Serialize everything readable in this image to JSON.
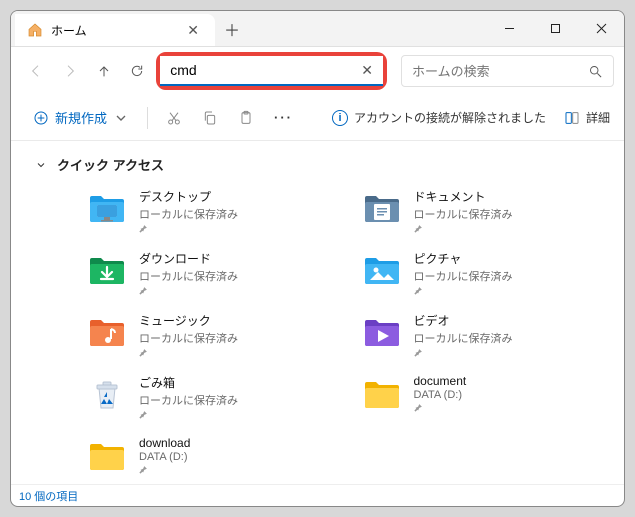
{
  "window": {
    "tab_title": "ホーム",
    "address_value": "cmd",
    "search_placeholder": "ホームの検索"
  },
  "toolbar": {
    "new_label": "新規作成",
    "more": "···",
    "account_msg": "アカウントの接続が解除されました",
    "details": "詳細"
  },
  "section": {
    "quick_access": "クイック アクセス"
  },
  "items": [
    {
      "name": "デスクトップ",
      "sub": "ローカルに保存済み",
      "icon": "desktop"
    },
    {
      "name": "ドキュメント",
      "sub": "ローカルに保存済み",
      "icon": "documents"
    },
    {
      "name": "ダウンロード",
      "sub": "ローカルに保存済み",
      "icon": "downloads"
    },
    {
      "name": "ピクチャ",
      "sub": "ローカルに保存済み",
      "icon": "pictures"
    },
    {
      "name": "ミュージック",
      "sub": "ローカルに保存済み",
      "icon": "music"
    },
    {
      "name": "ビデオ",
      "sub": "ローカルに保存済み",
      "icon": "videos"
    },
    {
      "name": "ごみ箱",
      "sub": "ローカルに保存済み",
      "icon": "recycle"
    },
    {
      "name": "document",
      "sub": "DATA (D:)",
      "icon": "folder"
    },
    {
      "name": "download",
      "sub": "DATA (D:)",
      "icon": "folder"
    }
  ],
  "status": "10 個の項目",
  "icons_svg": {
    "desktop": "<svg viewBox='0 0 40 40'><path d='M3 12 L3 10 Q3 8 5 8 L14 8 L17 11 L35 11 Q37 11 37 13 L37 32 Q37 34 35 34 L5 34 Q3 34 3 32 Z' fill='#1e9de6'/><rect x='3' y='14' width='34' height='20' rx='2' fill='#41b6f4'/><rect x='10' y='17' width='20' height='12' rx='1' fill='#fff'/><rect x='10' y='17' width='20' height='12' rx='1' fill='#3aa0e0'/><rect x='17' y='29' width='6' height='3' fill='#888'/><rect x='14' y='32' width='12' height='1.5' fill='#888'/></svg>",
    "documents": "<svg viewBox='0 0 40 40'><path d='M3 12 L3 10 Q3 8 5 8 L14 8 L17 11 L35 11 Q37 11 37 13 L37 32 Q37 34 35 34 L5 34 Q3 34 3 32 Z' fill='#4a6b8a'/><rect x='3' y='14' width='34' height='20' rx='2' fill='#6b8fb0'/><rect x='12' y='16' width='16' height='16' rx='1' fill='#fff'/><rect x='15' y='20' width='10' height='1.5' fill='#6b8fb0'/><rect x='15' y='23' width='10' height='1.5' fill='#6b8fb0'/><rect x='15' y='26' width='7' height='1.5' fill='#6b8fb0'/></svg>",
    "downloads": "<svg viewBox='0 0 40 40'><path d='M3 12 L3 10 Q3 8 5 8 L14 8 L17 11 L35 11 Q37 11 37 13 L37 32 Q37 34 35 34 L5 34 Q3 34 3 32 Z' fill='#0f8a4c'/><rect x='3' y='14' width='34' height='20' rx='2' fill='#1db663'/><path d='M20 17 L20 26 M15 22 L20 27 L25 22 M14 29 L26 29' stroke='#fff' stroke-width='2.2' fill='none' stroke-linecap='round' stroke-linejoin='round'/></svg>",
    "pictures": "<svg viewBox='0 0 40 40'><path d='M3 12 L3 10 Q3 8 5 8 L14 8 L17 11 L35 11 Q37 11 37 13 L37 32 Q37 34 35 34 L5 34 Q3 34 3 32 Z' fill='#1e9de6'/><rect x='3' y='14' width='34' height='20' rx='2' fill='#41b6f4'/><circle cx='14' cy='20' r='2.5' fill='#fff'/><path d='M8 30 L16 22 L22 28 L26 24 L32 30 Z' fill='#fff'/></svg>",
    "music": "<svg viewBox='0 0 40 40'><path d='M3 12 L3 10 Q3 8 5 8 L14 8 L17 11 L35 11 Q37 11 37 13 L37 32 Q37 34 35 34 L5 34 Q3 34 3 32 Z' fill='#e8602c'/><rect x='3' y='14' width='34' height='20' rx='2' fill='#f5844e'/><path d='M24 17 L24 27' stroke='#fff' stroke-width='2' fill='none'/><circle cx='21' cy='28' r='3' fill='#fff'/><path d='M24 17 Q28 18 28 21' stroke='#fff' stroke-width='2' fill='none'/></svg>",
    "videos": "<svg viewBox='0 0 40 40'><path d='M3 12 L3 10 Q3 8 5 8 L14 8 L17 11 L35 11 Q37 11 37 13 L37 32 Q37 34 35 34 L5 34 Q3 34 3 32 Z' fill='#6b3fc4'/><rect x='3' y='14' width='34' height='20' rx='2' fill='#8c5ce0'/><path d='M16 18 L27 24 L16 30 Z' fill='#fff'/></svg>",
    "recycle": "<svg viewBox='0 0 40 40'><path d='M12 14 L28 14 L26 34 L14 34 Z' fill='#e8eef5' stroke='#b8c4d4' stroke-width='1'/><rect x='10' y='11' width='20' height='4' rx='1' fill='#d6e0ec' stroke='#b8c4d4' stroke-width='1'/><rect x='16' y='8' width='8' height='3' rx='1' fill='#d6e0ec' stroke='#b8c4d4' stroke-width='1'/><path d='M20 18 L17 23 L20 23 Z M17 25 L14 30 L20 30 Z M22 25 L26 30 L20 30 Z' fill='#0a6bc6'/></svg>",
    "folder": "<svg viewBox='0 0 40 40'><path d='M3 12 L3 10 Q3 8 5 8 L14 8 L17 11 L35 11 Q37 11 37 13 L37 32 Q37 34 35 34 L5 34 Q3 34 3 32 Z' fill='#f2b200'/><rect x='3' y='14' width='34' height='20' rx='2' fill='#ffd24a'/></svg>"
  }
}
